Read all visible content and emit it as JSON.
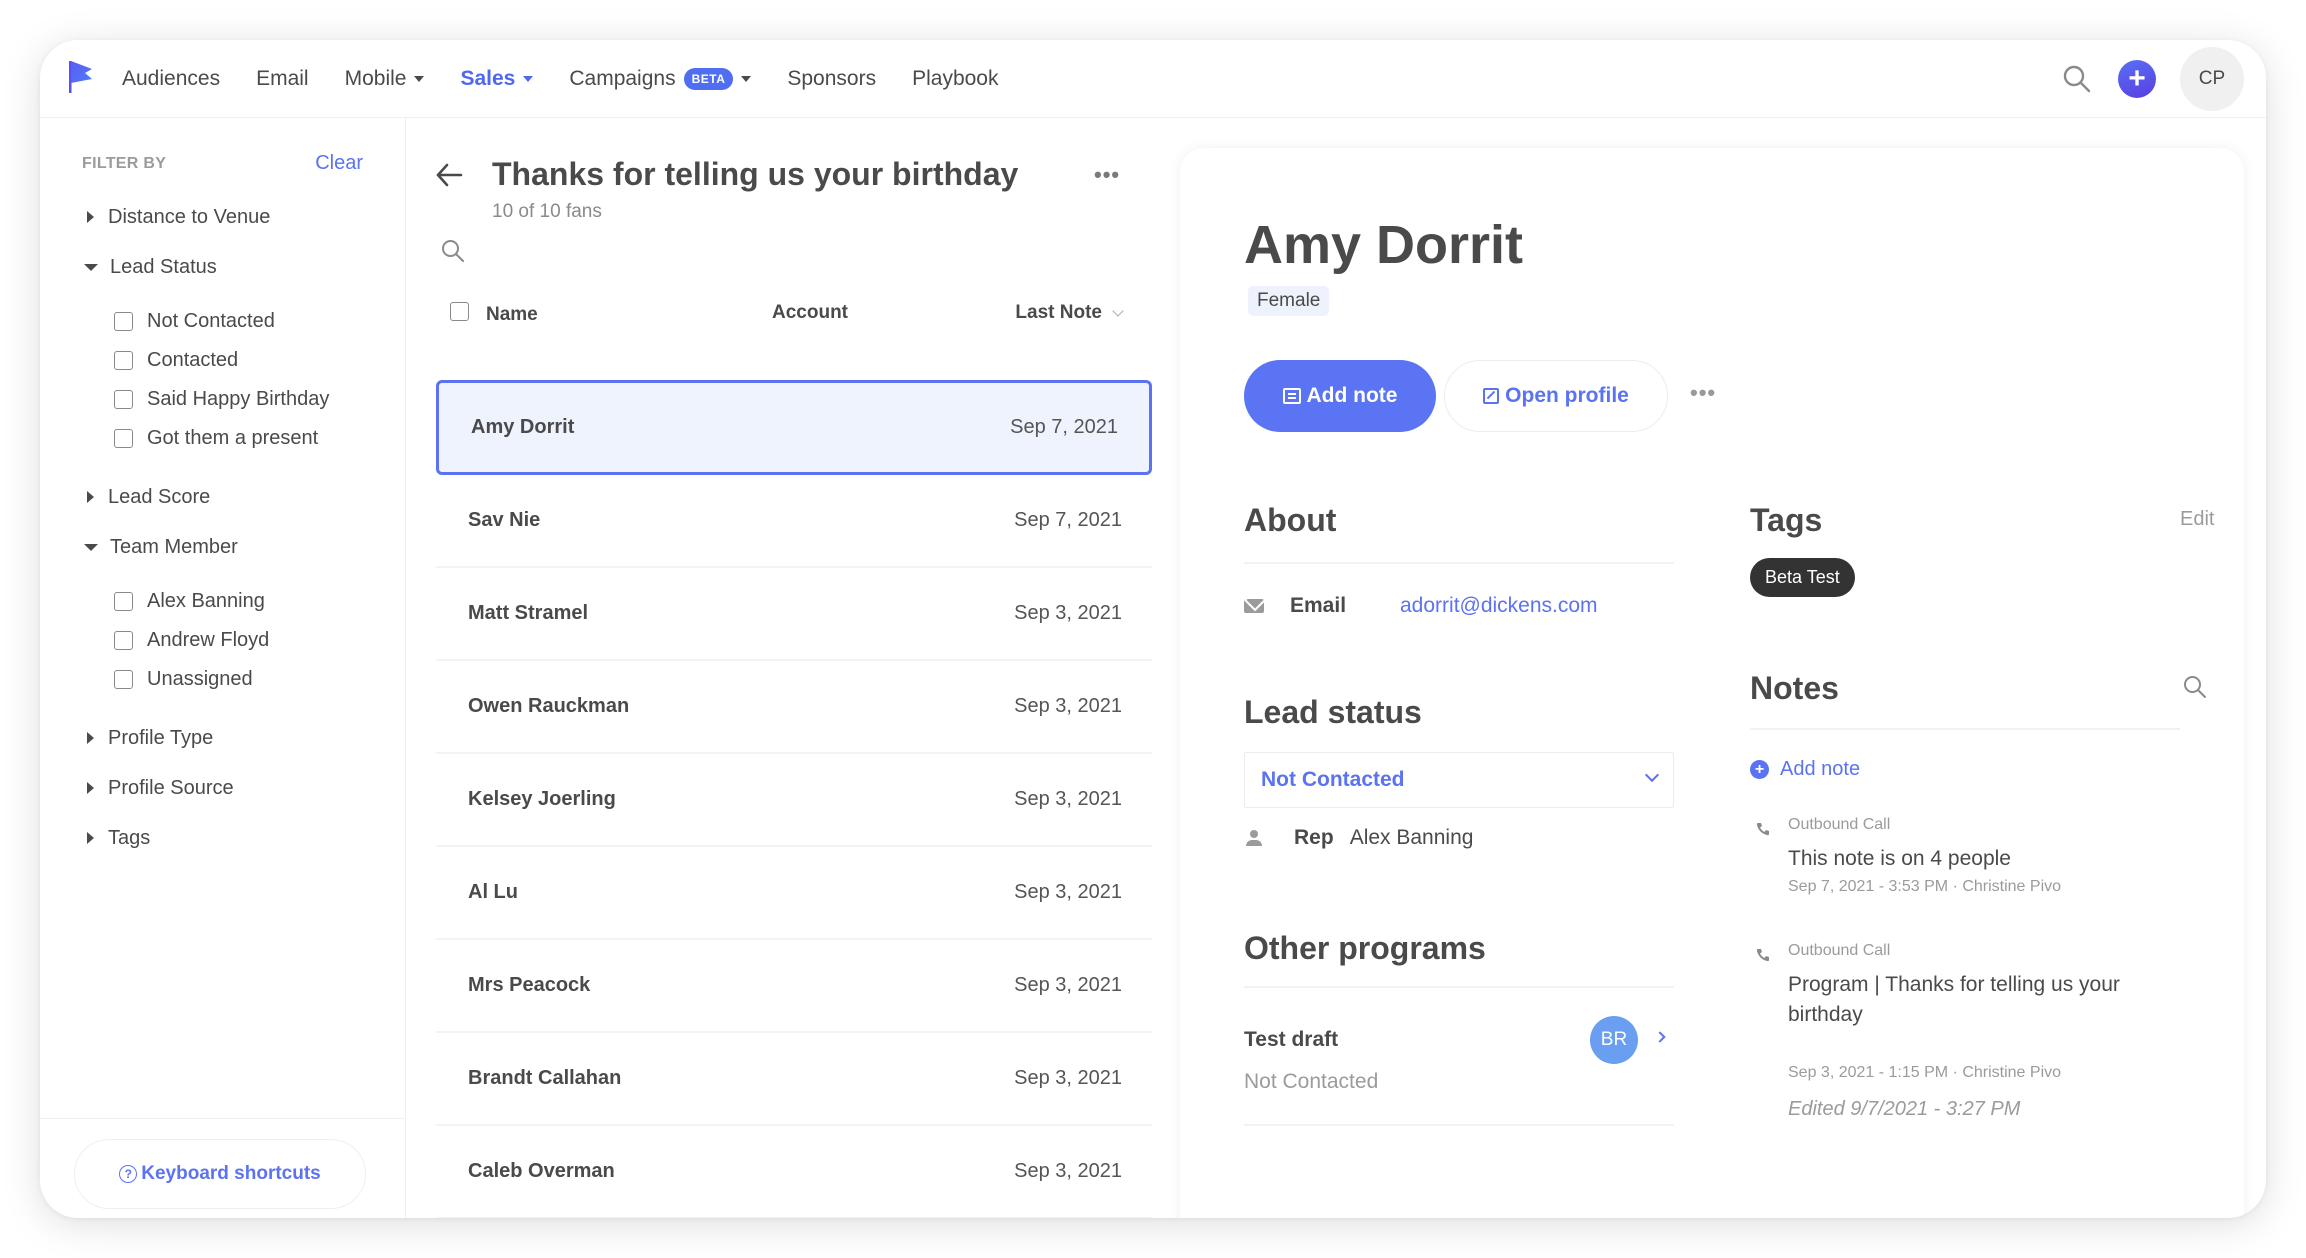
{
  "nav": {
    "items": [
      {
        "label": "Audiences",
        "dropdown": false
      },
      {
        "label": "Email",
        "dropdown": false
      },
      {
        "label": "Mobile",
        "dropdown": true
      },
      {
        "label": "Sales",
        "dropdown": true,
        "active": true
      },
      {
        "label": "Campaigns",
        "dropdown": true,
        "badge": "BETA"
      },
      {
        "label": "Sponsors",
        "dropdown": false
      },
      {
        "label": "Playbook",
        "dropdown": false
      }
    ],
    "avatar_initials": "CP",
    "accent_color": "#5067f0"
  },
  "sidebar": {
    "filter_by": "FILTER BY",
    "clear": "Clear",
    "groups": [
      {
        "label": "Distance to Venue",
        "expanded": false,
        "options": []
      },
      {
        "label": "Lead Status",
        "expanded": true,
        "options": [
          "Not Contacted",
          "Contacted",
          "Said Happy Birthday",
          "Got them a present"
        ]
      },
      {
        "label": "Lead Score",
        "expanded": false,
        "options": []
      },
      {
        "label": "Team Member",
        "expanded": true,
        "options": [
          "Alex Banning",
          "Andrew Floyd",
          "Unassigned"
        ]
      },
      {
        "label": "Profile Type",
        "expanded": false,
        "options": []
      },
      {
        "label": "Profile Source",
        "expanded": false,
        "options": []
      },
      {
        "label": "Tags",
        "expanded": false,
        "options": []
      }
    ],
    "keyboard_shortcuts": "Keyboard shortcuts"
  },
  "list": {
    "title": "Thanks for telling us your birthday",
    "subtitle": "10 of 10 fans",
    "more": "•••",
    "columns": {
      "name": "Name",
      "account": "Account",
      "last_note": "Last Note"
    },
    "rows": [
      {
        "name": "Amy Dorrit",
        "account": "",
        "last_note": "Sep 7, 2021",
        "selected": true
      },
      {
        "name": "Sav Nie",
        "account": "",
        "last_note": "Sep 7, 2021"
      },
      {
        "name": "Matt Stramel",
        "account": "",
        "last_note": "Sep 3, 2021"
      },
      {
        "name": "Owen Rauckman",
        "account": "",
        "last_note": "Sep 3, 2021"
      },
      {
        "name": "Kelsey Joerling",
        "account": "",
        "last_note": "Sep 3, 2021"
      },
      {
        "name": "Al Lu",
        "account": "",
        "last_note": "Sep 3, 2021"
      },
      {
        "name": "Mrs Peacock",
        "account": "",
        "last_note": "Sep 3, 2021"
      },
      {
        "name": "Brandt Callahan",
        "account": "",
        "last_note": "Sep 3, 2021"
      },
      {
        "name": "Caleb Overman",
        "account": "",
        "last_note": "Sep 3, 2021"
      }
    ]
  },
  "detail": {
    "name": "Amy Dorrit",
    "gender": "Female",
    "add_note": "Add note",
    "open_profile": "Open profile",
    "more": "•••",
    "about": {
      "title": "About",
      "email_label": "Email",
      "email": "adorrit@dickens.com"
    },
    "lead_status": {
      "title": "Lead status",
      "value": "Not Contacted",
      "rep_label": "Rep",
      "rep": "Alex Banning"
    },
    "other_programs": {
      "title": "Other programs",
      "items": [
        {
          "name": "Test draft",
          "status": "Not Contacted",
          "avatar": "BR"
        }
      ]
    },
    "tags": {
      "title": "Tags",
      "edit": "Edit",
      "items": [
        "Beta Test"
      ]
    },
    "notes": {
      "title": "Notes",
      "add_note": "Add note",
      "items": [
        {
          "type": "Outbound Call",
          "body": "This note is on 4 people",
          "meta": "Sep 7, 2021 - 3:53 PM · Christine Pivo",
          "edited": ""
        },
        {
          "type": "Outbound Call",
          "body": "Program | Thanks for telling us your birthday",
          "meta": "Sep 3, 2021 - 1:15 PM · Christine Pivo",
          "edited": "Edited 9/7/2021 - 3:27 PM"
        }
      ]
    }
  }
}
